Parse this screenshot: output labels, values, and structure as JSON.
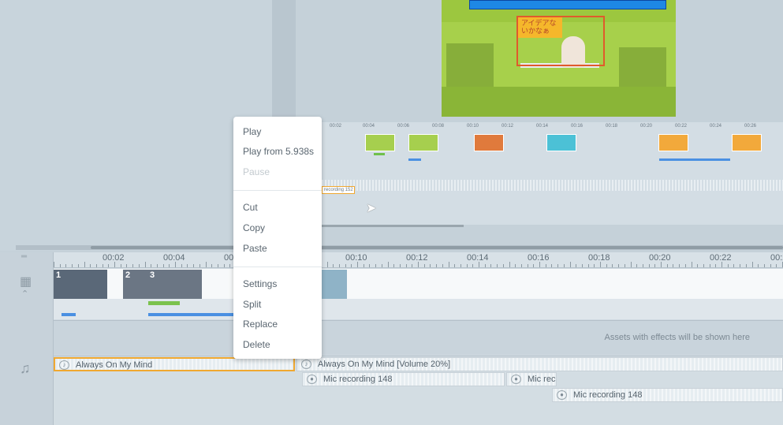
{
  "context_menu": {
    "items": [
      {
        "label": "Play",
        "enabled": true
      },
      {
        "label": "Play from 5.938s",
        "enabled": true
      },
      {
        "label": "Pause",
        "enabled": false
      },
      {
        "label": "Cut",
        "enabled": true
      },
      {
        "label": "Copy",
        "enabled": true
      },
      {
        "label": "Paste",
        "enabled": true
      },
      {
        "label": "Settings",
        "enabled": true
      },
      {
        "label": "Split",
        "enabled": true
      },
      {
        "label": "Replace",
        "enabled": true
      },
      {
        "label": "Delete",
        "enabled": true
      }
    ]
  },
  "timeline": {
    "ruler": [
      "00:02",
      "00:04",
      "00:06",
      "00:10",
      "00:12",
      "00:14",
      "00:16",
      "00:18",
      "00:20",
      "00:22",
      "00:2"
    ],
    "clip_numbers": [
      "1",
      "2",
      "3"
    ],
    "assets_hint": "Assets with effects will be shown here",
    "audio_clips": [
      "Always On My Mind",
      "Always On My Mind [Volume 20%]",
      "Mic recording 148",
      "Mic rec",
      "Mic recording 148"
    ]
  },
  "mini_timeline": {
    "ruler": [
      "00:02",
      "00:04",
      "00:06",
      "00:08",
      "00:10",
      "00:12",
      "00:14",
      "00:16",
      "00:18",
      "00:20",
      "00:22",
      "00:24",
      "00:26"
    ],
    "recording_label": "recording 152"
  },
  "preview": {
    "sign_text": "アイデアな いかなぁ"
  },
  "colors": {
    "accent": "#4a90e2",
    "selection": "#f0a830",
    "effect_green": "#7bc24d"
  }
}
